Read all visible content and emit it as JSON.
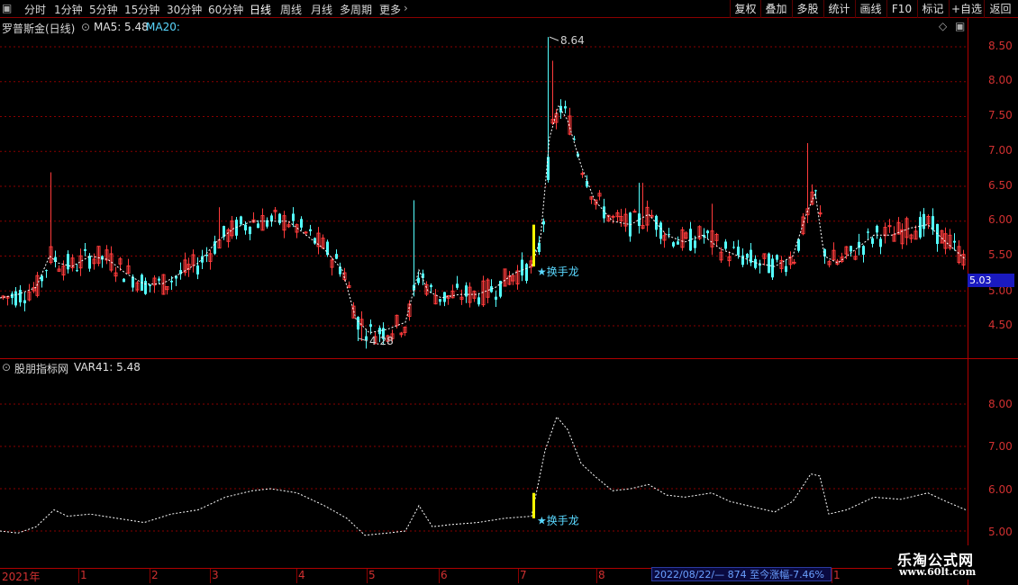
{
  "toolbar": {
    "periods": [
      "分时",
      "1分钟",
      "5分钟",
      "15分钟",
      "30分钟",
      "60分钟",
      "日线",
      "周线",
      "月线",
      "多周期",
      "更多"
    ],
    "active_period": "日线",
    "buttons": [
      "复权",
      "叠加",
      "多股",
      "统计",
      "画线",
      "F10",
      "标记",
      "+自选",
      "返回"
    ]
  },
  "main_legend": {
    "title": "罗普斯金(日线)",
    "ma5": "MA5: 5.48",
    "ma20": "MA20:"
  },
  "indicator_legend": {
    "title": "股朋指标网",
    "var41": "VAR41: 5.48"
  },
  "price_axis": [
    "8.50",
    "8.00",
    "7.50",
    "7.00",
    "6.50",
    "6.00",
    "5.50",
    "5.00",
    "4.50"
  ],
  "indicator_axis": [
    "8.00",
    "7.00",
    "6.00",
    "5.00"
  ],
  "current_price": "5.03",
  "annotations": {
    "high_label": "8.64",
    "low_label": "4.28",
    "signal_label": "★换手龙",
    "signal_label_ind": "★换手龙"
  },
  "date_axis": [
    "2021年",
    "1",
    "2",
    "3",
    "4",
    "5",
    "6",
    "7",
    "8",
    "1"
  ],
  "info_box": "2022/08/22/— 874 至今涨幅-7.46%",
  "watermark": {
    "title": "乐淘公式网",
    "url": "www.60lt.com"
  },
  "colors": {
    "up": "#ff3b3b",
    "down": "#54ffff",
    "grid": "#8a0000",
    "ma": "#ffffff",
    "signal": "#ffff00",
    "accent_text": "#5ad8ff"
  },
  "chart_data": {
    "type": "candlestick",
    "title": "罗普斯金(日线)",
    "price_ylim": [
      4.2,
      8.8
    ],
    "indicator_ylim": [
      4.8,
      8.9
    ],
    "high": 8.64,
    "low": 4.28,
    "last": 5.03,
    "ma5_last": 5.48,
    "var41_last": 5.48,
    "ma_series_approx": [
      [
        0,
        4.9
      ],
      [
        20,
        4.95
      ],
      [
        40,
        5.05
      ],
      [
        55,
        5.5
      ],
      [
        65,
        5.4
      ],
      [
        80,
        5.35
      ],
      [
        100,
        5.5
      ],
      [
        120,
        5.45
      ],
      [
        140,
        5.25
      ],
      [
        160,
        5.1
      ],
      [
        180,
        5.1
      ],
      [
        200,
        5.25
      ],
      [
        220,
        5.4
      ],
      [
        240,
        5.7
      ],
      [
        260,
        5.9
      ],
      [
        280,
        6.0
      ],
      [
        300,
        6.0
      ],
      [
        320,
        6.0
      ],
      [
        340,
        5.8
      ],
      [
        360,
        5.6
      ],
      [
        380,
        5.3
      ],
      [
        395,
        4.6
      ],
      [
        410,
        4.4
      ],
      [
        430,
        4.45
      ],
      [
        450,
        4.55
      ],
      [
        465,
        5.3
      ],
      [
        475,
        5.0
      ],
      [
        490,
        4.9
      ],
      [
        510,
        4.95
      ],
      [
        530,
        4.95
      ],
      [
        550,
        5.05
      ],
      [
        570,
        5.25
      ],
      [
        590,
        5.35
      ],
      [
        600,
        5.75
      ],
      [
        610,
        7.2
      ],
      [
        620,
        7.65
      ],
      [
        630,
        7.45
      ],
      [
        645,
        6.8
      ],
      [
        660,
        6.3
      ],
      [
        680,
        6.0
      ],
      [
        700,
        5.95
      ],
      [
        720,
        6.1
      ],
      [
        740,
        5.8
      ],
      [
        760,
        5.7
      ],
      [
        780,
        5.8
      ],
      [
        800,
        5.6
      ],
      [
        820,
        5.5
      ],
      [
        840,
        5.4
      ],
      [
        860,
        5.35
      ],
      [
        880,
        5.5
      ],
      [
        895,
        6.1
      ],
      [
        905,
        6.4
      ],
      [
        915,
        5.5
      ],
      [
        930,
        5.4
      ],
      [
        950,
        5.6
      ],
      [
        970,
        5.8
      ],
      [
        990,
        5.8
      ],
      [
        1010,
        5.9
      ],
      [
        1030,
        5.95
      ],
      [
        1050,
        5.7
      ],
      [
        1072,
        5.45
      ]
    ],
    "var41_series_approx": [
      [
        0,
        5.0
      ],
      [
        20,
        4.95
      ],
      [
        40,
        5.1
      ],
      [
        60,
        5.5
      ],
      [
        75,
        5.35
      ],
      [
        100,
        5.4
      ],
      [
        130,
        5.3
      ],
      [
        160,
        5.2
      ],
      [
        190,
        5.4
      ],
      [
        220,
        5.5
      ],
      [
        250,
        5.8
      ],
      [
        280,
        5.95
      ],
      [
        300,
        6.0
      ],
      [
        330,
        5.9
      ],
      [
        360,
        5.6
      ],
      [
        385,
        5.3
      ],
      [
        405,
        4.9
      ],
      [
        430,
        4.95
      ],
      [
        450,
        5.0
      ],
      [
        465,
        5.6
      ],
      [
        480,
        5.1
      ],
      [
        500,
        5.15
      ],
      [
        530,
        5.2
      ],
      [
        560,
        5.3
      ],
      [
        590,
        5.35
      ],
      [
        605,
        6.9
      ],
      [
        618,
        7.7
      ],
      [
        630,
        7.4
      ],
      [
        645,
        6.6
      ],
      [
        660,
        6.3
      ],
      [
        680,
        5.95
      ],
      [
        700,
        6.0
      ],
      [
        720,
        6.1
      ],
      [
        740,
        5.85
      ],
      [
        760,
        5.8
      ],
      [
        790,
        5.9
      ],
      [
        810,
        5.7
      ],
      [
        840,
        5.55
      ],
      [
        860,
        5.45
      ],
      [
        880,
        5.7
      ],
      [
        900,
        6.35
      ],
      [
        910,
        6.3
      ],
      [
        920,
        5.4
      ],
      [
        940,
        5.5
      ],
      [
        970,
        5.8
      ],
      [
        1000,
        5.75
      ],
      [
        1030,
        5.9
      ],
      [
        1050,
        5.7
      ],
      [
        1072,
        5.5
      ]
    ],
    "signal_marker": {
      "label": "★换手龙",
      "type": "buy-signal"
    }
  }
}
